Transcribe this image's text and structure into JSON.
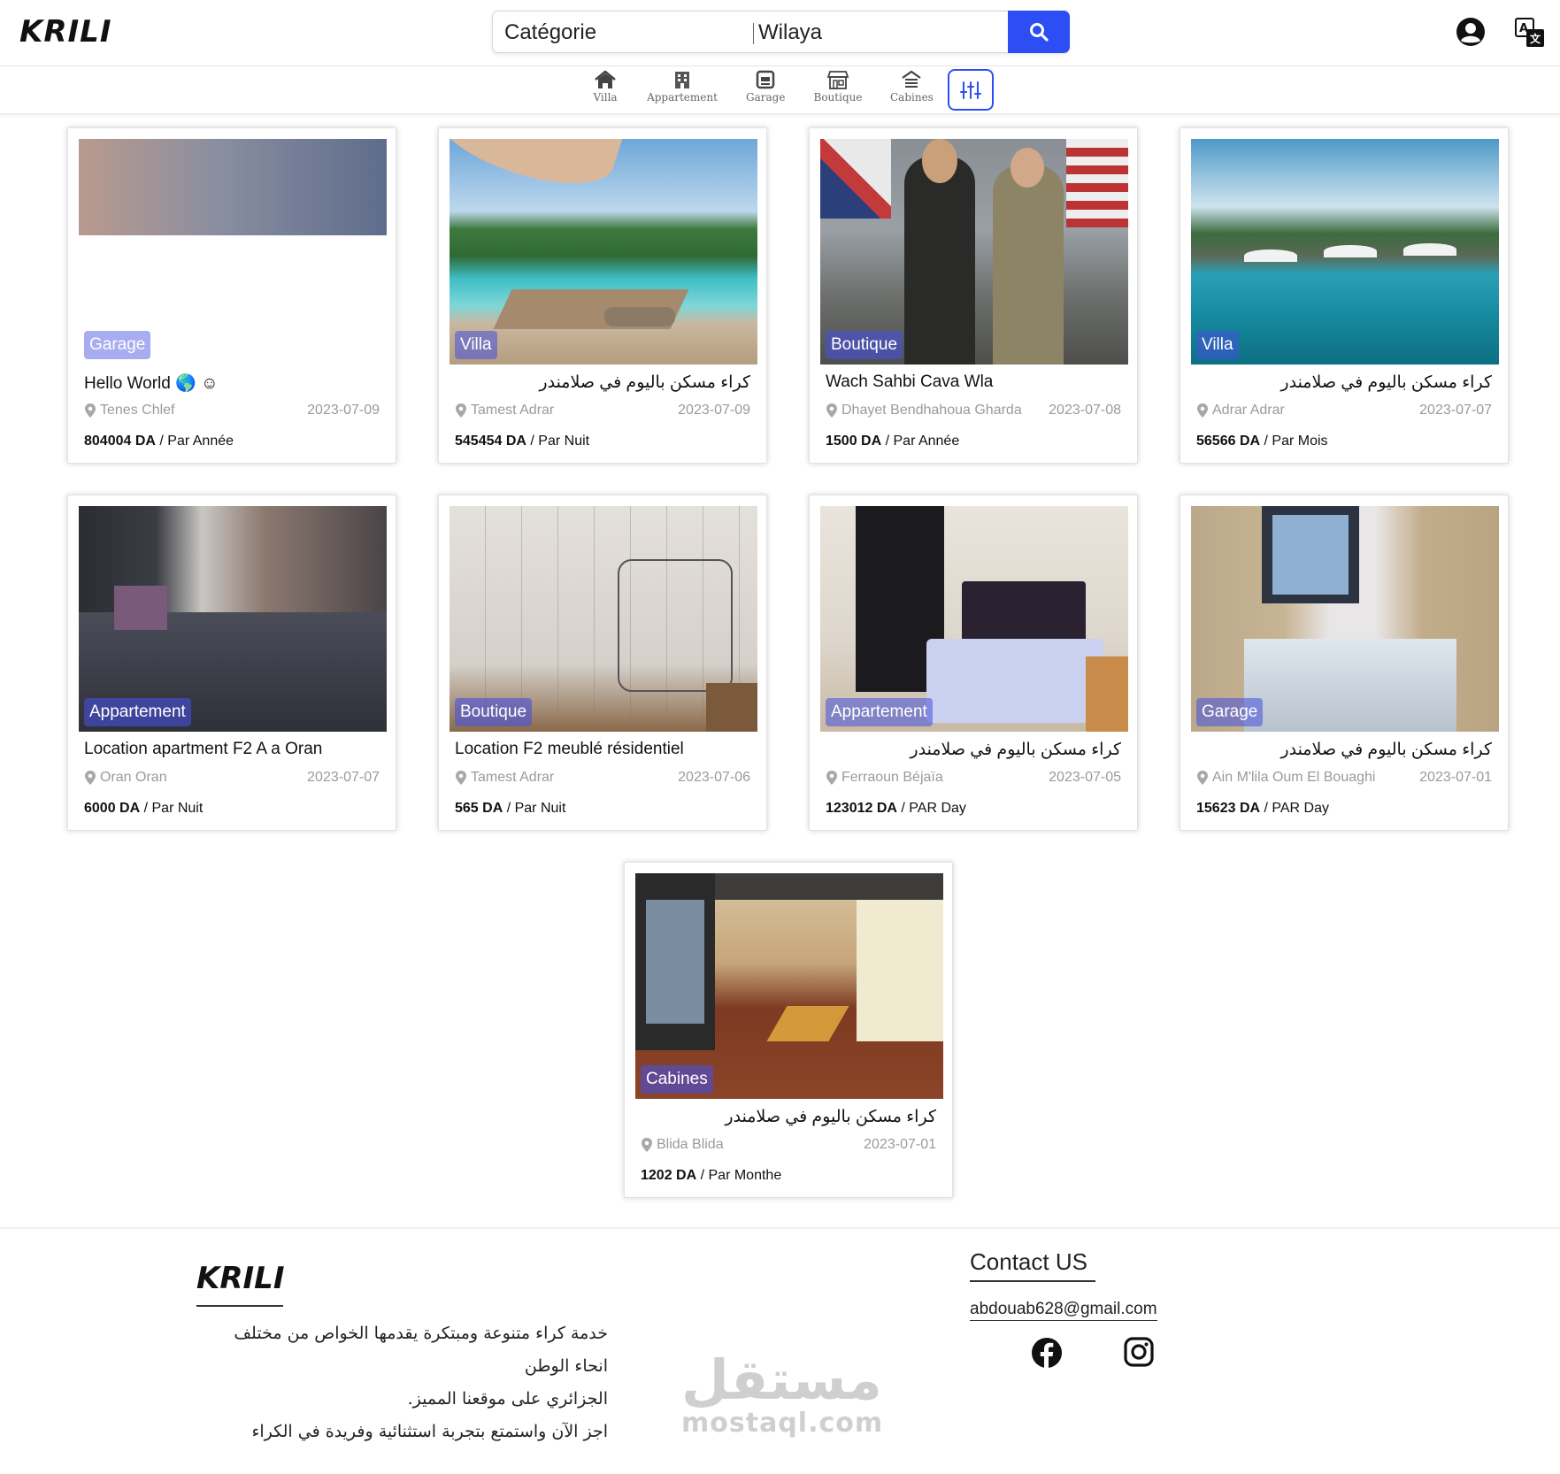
{
  "header": {
    "logo": "KRILI",
    "search": {
      "category_placeholder": "Catégorie",
      "wilaya_placeholder": "Wilaya"
    }
  },
  "categories": [
    {
      "label": "Villa",
      "icon": "home-icon"
    },
    {
      "label": "Appartement",
      "icon": "building-icon"
    },
    {
      "label": "Garage",
      "icon": "garage-icon"
    },
    {
      "label": "Boutique",
      "icon": "store-icon"
    },
    {
      "label": "Cabines",
      "icon": "cabin-icon"
    }
  ],
  "colors": {
    "accent": "#2d4ef5",
    "badge_bg": "rgba(70,80,220,0.55)"
  },
  "listings": [
    {
      "badge": "Garage",
      "title": "Hello World 🌎 ☺",
      "location": "Tenes Chlef",
      "date": "2023-07-09",
      "price": "804004 DA",
      "period": "/ Par Année"
    },
    {
      "badge": "Villa",
      "title": "كراء مسكن باليوم في صلامندر",
      "location": "Tamest Adrar",
      "date": "2023-07-09",
      "price": "545454 DA",
      "period": "/ Par Nuit"
    },
    {
      "badge": "Boutique",
      "title": "Wach Sahbi Cava Wla",
      "location": "Dhayet Bendhahoua Gharda",
      "date": "2023-07-08",
      "price": "1500 DA",
      "period": "/ Par Année"
    },
    {
      "badge": "Villa",
      "title": "كراء مسكن باليوم في صلامندر",
      "location": "Adrar Adrar",
      "date": "2023-07-07",
      "price": "56566 DA",
      "period": "/ Par Mois"
    },
    {
      "badge": "Appartement",
      "title": "Location apartment F2 A a Oran",
      "location": "Oran Oran",
      "date": "2023-07-07",
      "price": "6000 DA",
      "period": "/ Par Nuit"
    },
    {
      "badge": "Boutique",
      "title": "Location F2 meublé résidentiel",
      "location": "Tamest Adrar",
      "date": "2023-07-06",
      "price": "565 DA",
      "period": "/ Par Nuit"
    },
    {
      "badge": "Appartement",
      "title": "كراء مسكن باليوم في صلامندر",
      "location": "Ferraoun Béjaïa",
      "date": "2023-07-05",
      "price": "123012 DA",
      "period": "/ PAR Day"
    },
    {
      "badge": "Garage",
      "title": "كراء مسكن باليوم في صلامندر",
      "location": "Ain M'lila Oum El Bouaghi",
      "date": "2023-07-01",
      "price": "15623 DA",
      "period": "/ PAR Day"
    },
    {
      "badge": "Cabines",
      "title": "كراء مسكن باليوم في صلامندر",
      "location": "Blida Blida",
      "date": "2023-07-01",
      "price": "1202 DA",
      "period": "/ Par Monthe"
    }
  ],
  "footer": {
    "logo": "KRILI",
    "description_lines": [
      "خدمة كراء متنوعة ومبتكرة يقدمها الخواص من مختلف انحاء الوطن",
      "الجزائري على موقعنا المميز.",
      "اجز الآن واستمتع بتجربة استثنائية وفريدة في الكراء"
    ],
    "contact_title": "Contact US",
    "email": "abdouab628@gmail.com",
    "watermark_ar": "مستقل",
    "watermark_en": "mostaql.com"
  }
}
